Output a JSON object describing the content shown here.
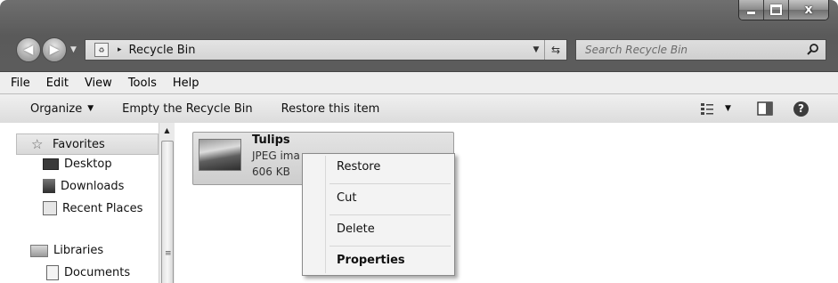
{
  "window": {
    "caption": {
      "minimize": "",
      "maximize": "",
      "close": "x"
    }
  },
  "address_bar": {
    "path": "Recycle Bin",
    "separator": "▸"
  },
  "search": {
    "placeholder": "Search Recycle Bin"
  },
  "menu_bar": [
    "File",
    "Edit",
    "View",
    "Tools",
    "Help"
  ],
  "command_bar": {
    "organize": "Organize",
    "empty": "Empty the Recycle Bin",
    "restore": "Restore this item"
  },
  "nav_pane": {
    "favorites": "Favorites",
    "desktop": "Desktop",
    "downloads": "Downloads",
    "recent": "Recent Places",
    "libraries": "Libraries",
    "documents": "Documents"
  },
  "file_item": {
    "name": "Tulips",
    "type": "JPEG ima",
    "size": "606 KB"
  },
  "context_menu": {
    "restore": "Restore",
    "cut": "Cut",
    "delete": "Delete",
    "properties": "Properties"
  }
}
